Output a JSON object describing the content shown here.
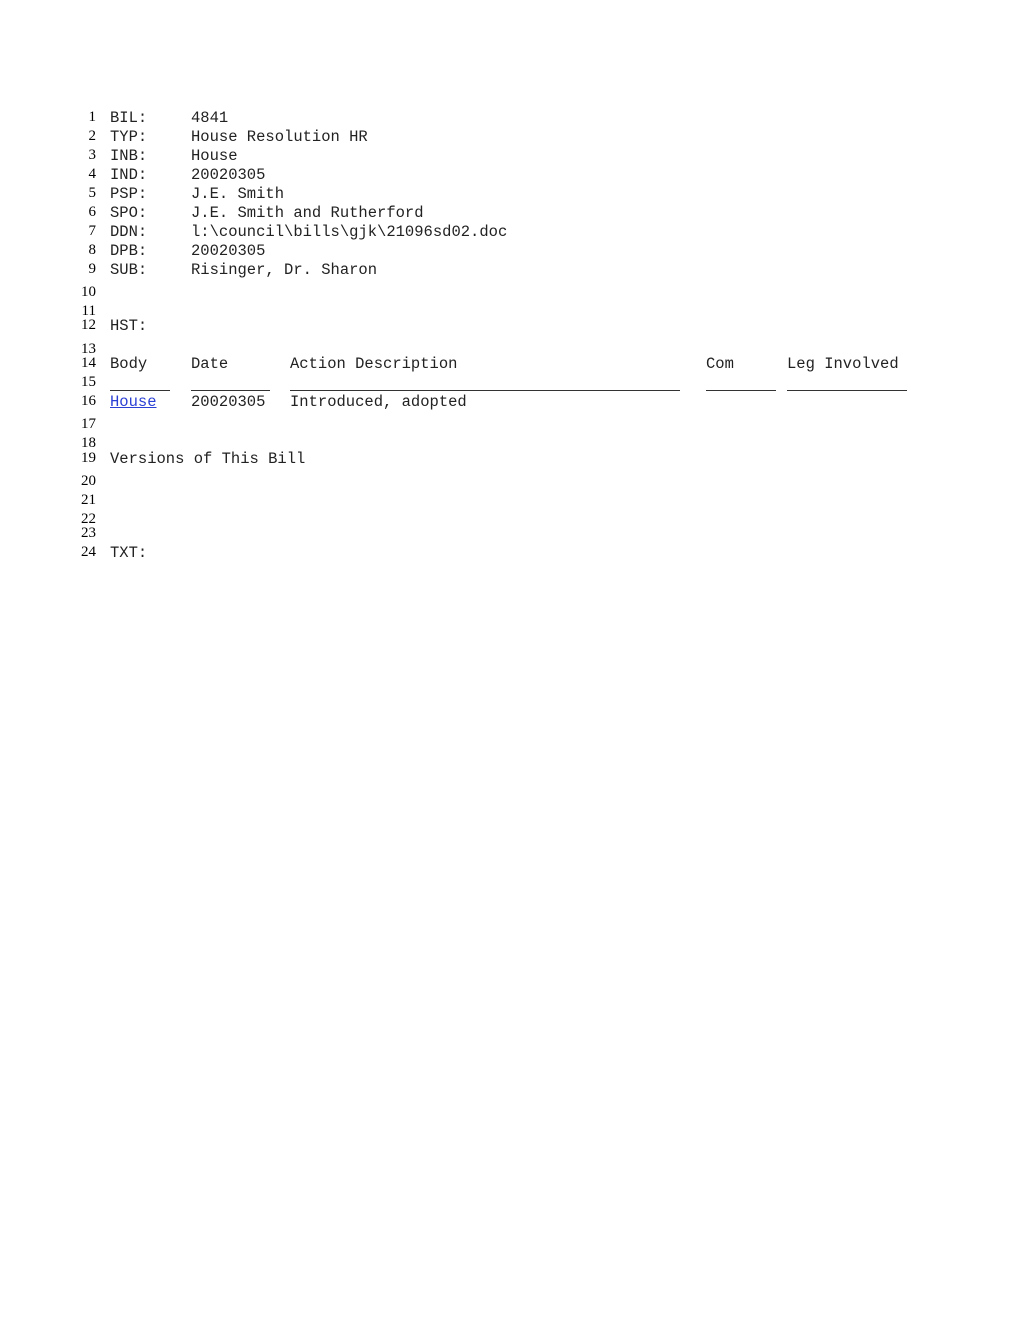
{
  "header_fields": [
    {
      "key": "BIL:",
      "value": "4841"
    },
    {
      "key": "TYP:",
      "value": "House Resolution HR"
    },
    {
      "key": "INB:",
      "value": "House"
    },
    {
      "key": "IND:",
      "value": "20020305"
    },
    {
      "key": "PSP:",
      "value": "J.E. Smith"
    },
    {
      "key": "SPO:",
      "value": "J.E. Smith and Rutherford"
    },
    {
      "key": "DDN:",
      "value": "l:\\council\\bills\\gjk\\21096sd02.doc"
    },
    {
      "key": "DPB:",
      "value": "20020305"
    },
    {
      "key": "SUB:",
      "value": "Risinger, Dr. Sharon"
    }
  ],
  "line_numbers": [
    "1",
    "2",
    "3",
    "4",
    "5",
    "6",
    "7",
    "8",
    "9",
    "10",
    "11",
    "12",
    "13",
    "14",
    "15",
    "16",
    "17",
    "18",
    "19",
    "20",
    "21",
    "22",
    "23",
    "24"
  ],
  "history": {
    "label": "HST:",
    "columns": [
      "Body",
      "Date",
      "Action Description",
      "Com",
      "Leg Involved"
    ],
    "rows": [
      {
        "body": "House",
        "date": "20020305",
        "action": "Introduced, adopted",
        "com": "",
        "leg": ""
      }
    ]
  },
  "versions_label": "Versions of This Bill",
  "text_label": "TXT:"
}
